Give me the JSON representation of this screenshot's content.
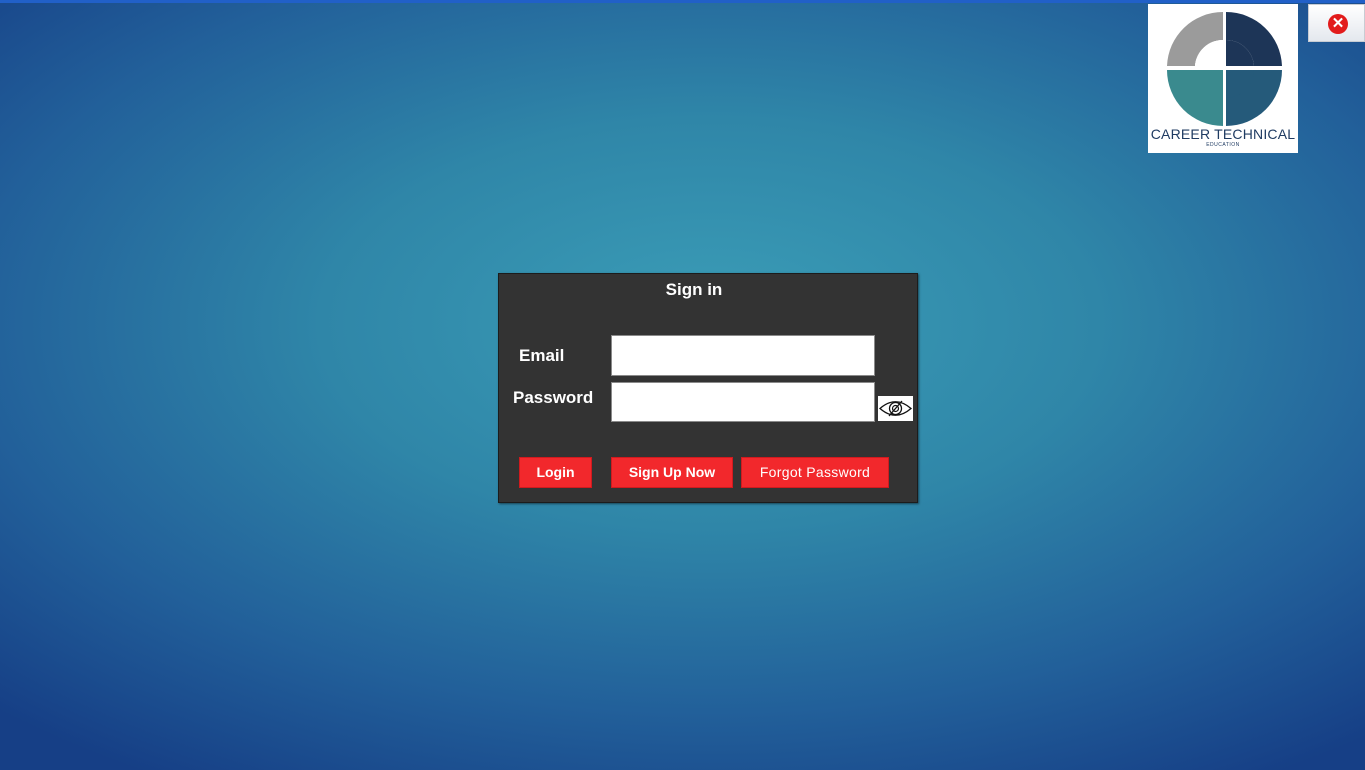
{
  "logo": {
    "name": "CAREER TECHNICAL",
    "subtitle": "EDUCATION",
    "colors": [
      "#9b9b9b",
      "#1d3557",
      "#3a8a8e",
      "#255a7a"
    ]
  },
  "window": {
    "close_icon": "close-icon",
    "close_glyph": "✕"
  },
  "signin": {
    "title": "Sign in",
    "email_label": "Email",
    "email_value": "",
    "password_label": "Password",
    "password_value": "",
    "toggle_icon": "eye-slash-icon",
    "buttons": {
      "login": "Login",
      "signup": "Sign Up Now",
      "forgot": "Forgot Password"
    }
  },
  "colors": {
    "panel": "#333333",
    "button": "#f2282c",
    "close": "#e21b1b",
    "background": "#2f86a8"
  }
}
